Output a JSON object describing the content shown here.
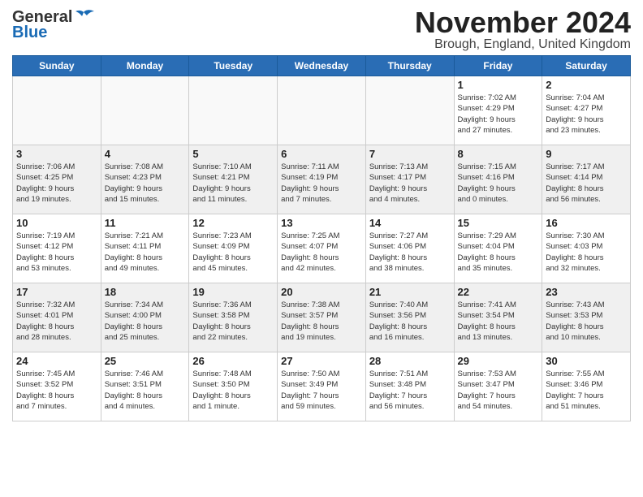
{
  "header": {
    "logo_line1": "General",
    "logo_line2": "Blue",
    "month_title": "November 2024",
    "location": "Brough, England, United Kingdom"
  },
  "days_of_week": [
    "Sunday",
    "Monday",
    "Tuesday",
    "Wednesday",
    "Thursday",
    "Friday",
    "Saturday"
  ],
  "weeks": [
    [
      {
        "day": "",
        "info": ""
      },
      {
        "day": "",
        "info": ""
      },
      {
        "day": "",
        "info": ""
      },
      {
        "day": "",
        "info": ""
      },
      {
        "day": "",
        "info": ""
      },
      {
        "day": "1",
        "info": "Sunrise: 7:02 AM\nSunset: 4:29 PM\nDaylight: 9 hours\nand 27 minutes."
      },
      {
        "day": "2",
        "info": "Sunrise: 7:04 AM\nSunset: 4:27 PM\nDaylight: 9 hours\nand 23 minutes."
      }
    ],
    [
      {
        "day": "3",
        "info": "Sunrise: 7:06 AM\nSunset: 4:25 PM\nDaylight: 9 hours\nand 19 minutes."
      },
      {
        "day": "4",
        "info": "Sunrise: 7:08 AM\nSunset: 4:23 PM\nDaylight: 9 hours\nand 15 minutes."
      },
      {
        "day": "5",
        "info": "Sunrise: 7:10 AM\nSunset: 4:21 PM\nDaylight: 9 hours\nand 11 minutes."
      },
      {
        "day": "6",
        "info": "Sunrise: 7:11 AM\nSunset: 4:19 PM\nDaylight: 9 hours\nand 7 minutes."
      },
      {
        "day": "7",
        "info": "Sunrise: 7:13 AM\nSunset: 4:17 PM\nDaylight: 9 hours\nand 4 minutes."
      },
      {
        "day": "8",
        "info": "Sunrise: 7:15 AM\nSunset: 4:16 PM\nDaylight: 9 hours\nand 0 minutes."
      },
      {
        "day": "9",
        "info": "Sunrise: 7:17 AM\nSunset: 4:14 PM\nDaylight: 8 hours\nand 56 minutes."
      }
    ],
    [
      {
        "day": "10",
        "info": "Sunrise: 7:19 AM\nSunset: 4:12 PM\nDaylight: 8 hours\nand 53 minutes."
      },
      {
        "day": "11",
        "info": "Sunrise: 7:21 AM\nSunset: 4:11 PM\nDaylight: 8 hours\nand 49 minutes."
      },
      {
        "day": "12",
        "info": "Sunrise: 7:23 AM\nSunset: 4:09 PM\nDaylight: 8 hours\nand 45 minutes."
      },
      {
        "day": "13",
        "info": "Sunrise: 7:25 AM\nSunset: 4:07 PM\nDaylight: 8 hours\nand 42 minutes."
      },
      {
        "day": "14",
        "info": "Sunrise: 7:27 AM\nSunset: 4:06 PM\nDaylight: 8 hours\nand 38 minutes."
      },
      {
        "day": "15",
        "info": "Sunrise: 7:29 AM\nSunset: 4:04 PM\nDaylight: 8 hours\nand 35 minutes."
      },
      {
        "day": "16",
        "info": "Sunrise: 7:30 AM\nSunset: 4:03 PM\nDaylight: 8 hours\nand 32 minutes."
      }
    ],
    [
      {
        "day": "17",
        "info": "Sunrise: 7:32 AM\nSunset: 4:01 PM\nDaylight: 8 hours\nand 28 minutes."
      },
      {
        "day": "18",
        "info": "Sunrise: 7:34 AM\nSunset: 4:00 PM\nDaylight: 8 hours\nand 25 minutes."
      },
      {
        "day": "19",
        "info": "Sunrise: 7:36 AM\nSunset: 3:58 PM\nDaylight: 8 hours\nand 22 minutes."
      },
      {
        "day": "20",
        "info": "Sunrise: 7:38 AM\nSunset: 3:57 PM\nDaylight: 8 hours\nand 19 minutes."
      },
      {
        "day": "21",
        "info": "Sunrise: 7:40 AM\nSunset: 3:56 PM\nDaylight: 8 hours\nand 16 minutes."
      },
      {
        "day": "22",
        "info": "Sunrise: 7:41 AM\nSunset: 3:54 PM\nDaylight: 8 hours\nand 13 minutes."
      },
      {
        "day": "23",
        "info": "Sunrise: 7:43 AM\nSunset: 3:53 PM\nDaylight: 8 hours\nand 10 minutes."
      }
    ],
    [
      {
        "day": "24",
        "info": "Sunrise: 7:45 AM\nSunset: 3:52 PM\nDaylight: 8 hours\nand 7 minutes."
      },
      {
        "day": "25",
        "info": "Sunrise: 7:46 AM\nSunset: 3:51 PM\nDaylight: 8 hours\nand 4 minutes."
      },
      {
        "day": "26",
        "info": "Sunrise: 7:48 AM\nSunset: 3:50 PM\nDaylight: 8 hours\nand 1 minute."
      },
      {
        "day": "27",
        "info": "Sunrise: 7:50 AM\nSunset: 3:49 PM\nDaylight: 7 hours\nand 59 minutes."
      },
      {
        "day": "28",
        "info": "Sunrise: 7:51 AM\nSunset: 3:48 PM\nDaylight: 7 hours\nand 56 minutes."
      },
      {
        "day": "29",
        "info": "Sunrise: 7:53 AM\nSunset: 3:47 PM\nDaylight: 7 hours\nand 54 minutes."
      },
      {
        "day": "30",
        "info": "Sunrise: 7:55 AM\nSunset: 3:46 PM\nDaylight: 7 hours\nand 51 minutes."
      }
    ]
  ]
}
